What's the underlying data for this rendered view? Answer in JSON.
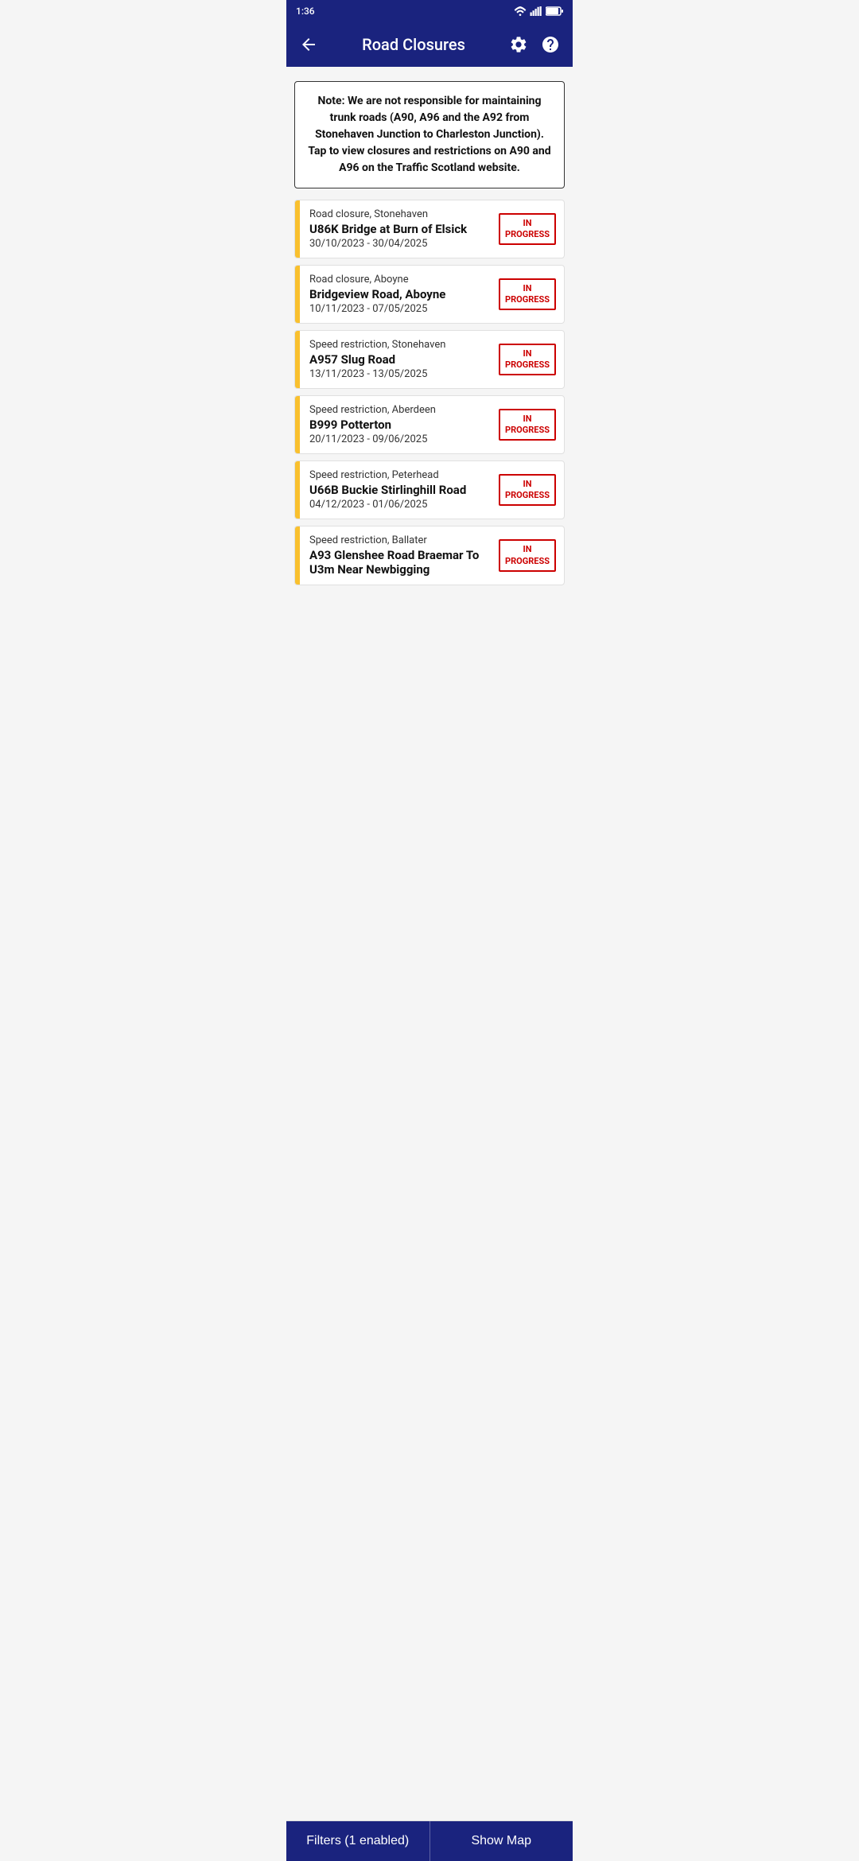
{
  "statusBar": {
    "time": "1:36",
    "icons": [
      "notification",
      "signal",
      "battery"
    ]
  },
  "appBar": {
    "title": "Road Closures",
    "backLabel": "back",
    "settingsLabel": "settings",
    "helpLabel": "help"
  },
  "notice": {
    "text": "Note: We are not responsible for maintaining trunk roads (A90, A96 and the A92 from Stonehaven Junction to Charleston Junction). Tap to view closures and restrictions on A90 and A96 on the Traffic Scotland website."
  },
  "closures": [
    {
      "type": "Road closure, Stonehaven",
      "location": "U86K Bridge at Burn of Elsick",
      "dates": "30/10/2023 - 30/04/2025",
      "badge": "IN\nPROGRESS"
    },
    {
      "type": "Road closure, Aboyne",
      "location": "Bridgeview Road, Aboyne",
      "dates": "10/11/2023 - 07/05/2025",
      "badge": "IN\nPROGRESS"
    },
    {
      "type": "Speed restriction, Stonehaven",
      "location": "A957 Slug Road",
      "dates": "13/11/2023 - 13/05/2025",
      "badge": "IN\nPROGRESS"
    },
    {
      "type": "Speed restriction, Aberdeen",
      "location": "B999 Potterton",
      "dates": "20/11/2023 - 09/06/2025",
      "badge": "IN\nPROGRESS"
    },
    {
      "type": "Speed restriction, Peterhead",
      "location": "U66B Buckie Stirlinghill Road",
      "dates": "04/12/2023 - 01/06/2025",
      "badge": "IN\nPROGRESS"
    },
    {
      "type": "Speed restriction, Ballater",
      "location": "A93 Glenshee Road Braemar To U3m Near Newbigging",
      "dates": "",
      "badge": "IN\nPROGRESS"
    }
  ],
  "bottomBar": {
    "filtersLabel": "Filters (1 enabled)",
    "showMapLabel": "Show Map"
  }
}
